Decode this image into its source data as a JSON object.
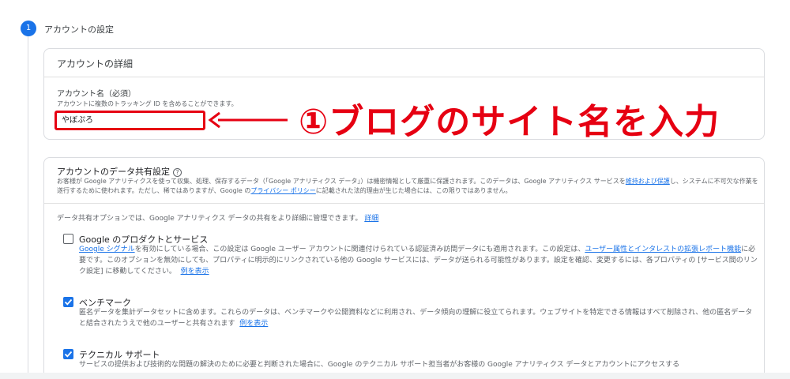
{
  "step": {
    "number": "1",
    "title": "アカウントの設定"
  },
  "account_details": {
    "heading": "アカウントの詳細",
    "name_label": "アカウント名（必須）",
    "name_hint": "アカウントに複数のトラッキング ID を含めることができます。",
    "name_value": "やぼぷろ"
  },
  "annotation": {
    "text": "①ブログのサイト名を入力",
    "color": "#e60012"
  },
  "data_sharing": {
    "heading": "アカウントのデータ共有設定",
    "help_icon": "?",
    "desc_1": "お客様が Google アナリティクスを使って収集、処理、保存するデータ（「Google アナリティクス データ」）は機密情報として厳重に保護されます。このデータは、Google アナリティクス サービスを",
    "desc_link_1": "維持および保護",
    "desc_2": "し、システムに不可欠な作業を遂行するために使われます。ただし、稀ではありますが、Google の",
    "desc_link_2": "プライバシー ポリシー",
    "desc_3": "に記載された法的理由が生じた場合には、この限りではありません。",
    "intro": "データ共有オプションでは、Google アナリティクス データの共有をより詳細に管理できます。",
    "intro_link": "詳細",
    "options": [
      {
        "title": "Google のプロダクトとサービス",
        "checked": false,
        "link_a": "Google シグナル",
        "text_a": "を有効にしている場合、この設定は Google ユーザー アカウントに関連付けられている認証済み訪問データにも適用されます。この設定は、",
        "link_b": "ユーザー属性とインタレストの拡張レポート機能",
        "text_b": "に必要です。このオプションを無効にしても、プロパティに明示的にリンクされている他の Google サービスには、データが送られる可能性があります。設定を確認、変更するには、各プロパティの [サービス間のリンク設定] に移動してください。",
        "example": "例を表示"
      },
      {
        "title": "ベンチマーク",
        "checked": true,
        "text": "匿名データを集計データセットに含めます。これらのデータは、ベンチマークや公開資料などに利用され、データ傾向の理解に役立てられます。ウェブサイトを特定できる情報はすべて削除され、他の匿名データと結合されたうえで他のユーザーと共有されます",
        "example": "例を表示"
      },
      {
        "title": "テクニカル サポート",
        "checked": true,
        "text": "サービスの提供および技術的な問題の解決のために必要と判断された場合に、Google のテクニカル サポート担当者がお客様の Google アナリティクス データとアカウントにアクセスする"
      }
    ]
  },
  "colors": {
    "accent": "#1a73e8",
    "annotation_red": "#e60012"
  }
}
